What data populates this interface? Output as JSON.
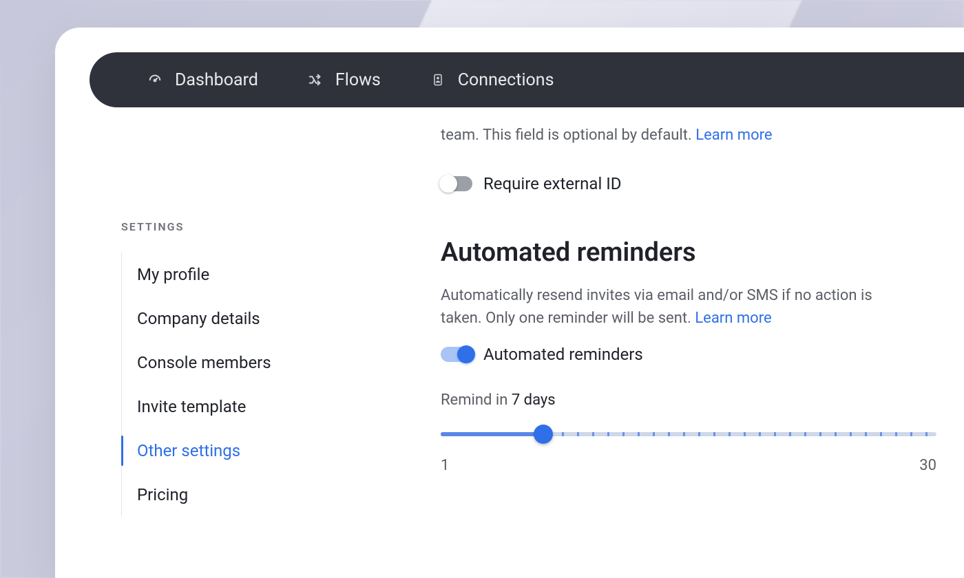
{
  "nav": {
    "dashboard": "Dashboard",
    "flows": "Flows",
    "connections": "Connections"
  },
  "sidebar": {
    "heading": "SETTINGS",
    "items": [
      {
        "label": "My profile"
      },
      {
        "label": "Company details"
      },
      {
        "label": "Console members"
      },
      {
        "label": "Invite template"
      },
      {
        "label": "Other settings"
      },
      {
        "label": "Pricing"
      }
    ],
    "active_index": 4
  },
  "external_id": {
    "desc_suffix": "team. This field is optional by default. ",
    "learn_more": "Learn more",
    "toggle_label": "Require external ID",
    "enabled": false
  },
  "reminders": {
    "title": "Automated reminders",
    "desc": "Automatically resend invites via email and/or SMS if no action is taken. Only one reminder will be sent. ",
    "learn_more": "Learn more",
    "toggle_label": "Automated reminders",
    "enabled": true,
    "remind_prefix": "Remind in ",
    "remind_value": "7 days",
    "slider": {
      "min": 1,
      "max": 30,
      "value": 7,
      "min_label": "1",
      "max_label": "30"
    }
  },
  "colors": {
    "accent": "#2f6fe8"
  }
}
